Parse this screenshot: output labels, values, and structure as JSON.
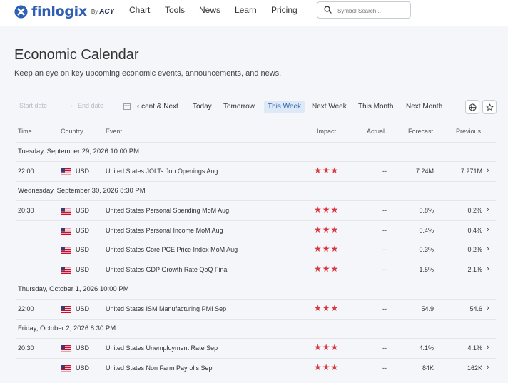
{
  "brand": {
    "name": "finlogix",
    "by": "By",
    "partner": "ACY"
  },
  "nav": [
    "Chart",
    "Tools",
    "News",
    "Learn",
    "Pricing"
  ],
  "search": {
    "placeholder": "Symbol Search..."
  },
  "page": {
    "title": "Economic Calendar",
    "subtitle": "Keep an eye on key upcoming economic events, announcements, and news."
  },
  "filters": {
    "start_placeholder": "Start date",
    "end_placeholder": "End date",
    "tabs": [
      "cent & Next",
      "Today",
      "Tomorrow",
      "This Week",
      "Next Week",
      "This Month",
      "Next Month"
    ],
    "active_tab": "This Week"
  },
  "columns": [
    "Time",
    "Country",
    "Event",
    "Impact",
    "Actual",
    "Forecast",
    "Previous"
  ],
  "groups": [
    {
      "date": "Tuesday, September 29, 2026 10:00 PM",
      "events": [
        {
          "time": "22:00",
          "country": "USD",
          "event": "United States JOLTs Job Openings Aug",
          "impact": 3,
          "impact_stars": "★★★",
          "actual": "--",
          "forecast": "7.24M",
          "previous": "7.271M"
        }
      ]
    },
    {
      "date": "Wednesday, September 30, 2026 8:30 PM",
      "events": [
        {
          "time": "20:30",
          "country": "USD",
          "event": "United States Personal Spending MoM Aug",
          "impact": 3,
          "impact_stars": "★★★",
          "actual": "--",
          "forecast": "0.8%",
          "previous": "0.2%"
        },
        {
          "time": "",
          "country": "USD",
          "event": "United States Personal Income MoM Aug",
          "impact": 3,
          "impact_stars": "★★★",
          "actual": "--",
          "forecast": "0.4%",
          "previous": "0.4%"
        },
        {
          "time": "",
          "country": "USD",
          "event": "United States Core PCE Price Index MoM Aug",
          "impact": 3,
          "impact_stars": "★★★",
          "actual": "--",
          "forecast": "0.3%",
          "previous": "0.2%"
        },
        {
          "time": "",
          "country": "USD",
          "event": "United States GDP Growth Rate QoQ Final",
          "impact": 3,
          "impact_stars": "★★★",
          "actual": "--",
          "forecast": "1.5%",
          "previous": "2.1%"
        }
      ]
    },
    {
      "date": "Thursday, October 1, 2026 10:00 PM",
      "events": [
        {
          "time": "22:00",
          "country": "USD",
          "event": "United States ISM Manufacturing PMI Sep",
          "impact": 3,
          "impact_stars": "★★★",
          "actual": "--",
          "forecast": "54.9",
          "previous": "54.6"
        }
      ]
    },
    {
      "date": "Friday, October 2, 2026 8:30 PM",
      "events": [
        {
          "time": "20:30",
          "country": "USD",
          "event": "United States Unemployment Rate Sep",
          "impact": 3,
          "impact_stars": "★★★",
          "actual": "--",
          "forecast": "4.1%",
          "previous": "4.1%"
        },
        {
          "time": "",
          "country": "USD",
          "event": "United States Non Farm Payrolls Sep",
          "impact": 3,
          "impact_stars": "★★★",
          "actual": "--",
          "forecast": "84K",
          "previous": "162K"
        }
      ]
    }
  ],
  "colors": {
    "brand": "#2f5fb3",
    "impact_star": "#d9363e",
    "active_tab_bg": "#dde9f7",
    "page_bg": "#f4f6f9"
  }
}
